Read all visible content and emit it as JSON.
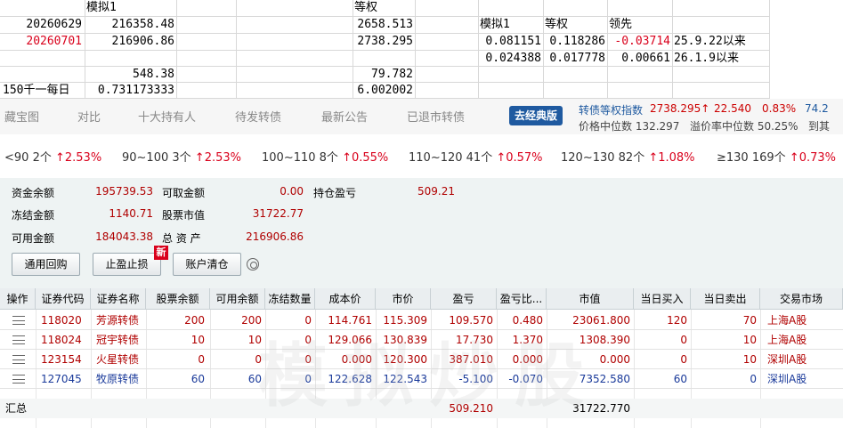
{
  "sheet": {
    "hdr_moni": "模拟1",
    "hdr_dengquan": "等权",
    "r1_date": "20260629",
    "r1_val": "216358.48",
    "r1_idx": "2658.513",
    "r2_date": "20260701",
    "r2_val": "216906.86",
    "r2_idx": "2738.295",
    "sub_hdr_moni": "模拟1",
    "sub_hdr_dengquan": "等权",
    "sub_hdr_lingxian": "领先",
    "s1_moni": "0.081151",
    "s1_dq": "0.118286",
    "s1_lead": "-0.03714",
    "s1_since": "25.9.22以来",
    "s2_moni": "0.024388",
    "s2_dq": "0.017778",
    "s2_lead": "0.00661",
    "s2_since": "26.1.9以来",
    "r4_val": "548.38",
    "r4_idx": "79.782",
    "r5_label": "150千一每日",
    "r5_val": "0.731173333",
    "r5_idx": "6.002002"
  },
  "tabs": {
    "items": [
      "藏宝图",
      "对比",
      "十大持有人",
      "待发转债",
      "最新公告",
      "已退市转债"
    ],
    "classic": "去经典版",
    "index_label": "转债等权指数",
    "index_value": "2738.295↑",
    "index_change": "22.540",
    "index_pct": "0.83%",
    "index_extra": "74.2",
    "median_price": "价格中位数 132.297",
    "premium_median": "溢价率中位数 50.25%",
    "due_label": "到其"
  },
  "buckets": [
    {
      "label": "<90 2个",
      "pct": "↑2.53%"
    },
    {
      "label": "90~100 3个",
      "pct": "↑2.53%"
    },
    {
      "label": "100~110 8个",
      "pct": "↑0.55%"
    },
    {
      "label": "110~120 41个",
      "pct": "↑0.57%"
    },
    {
      "label": "120~130 82个",
      "pct": "↑1.08%"
    },
    {
      "label": "≥130 169个",
      "pct": "↑0.73%"
    }
  ],
  "account": {
    "fund_balance_label": "资金余额",
    "fund_balance": "195739.53",
    "withdrawable_label": "可取金额",
    "withdrawable": "0.00",
    "position_pnl_label": "持仓盈亏",
    "position_pnl": "509.21",
    "frozen_label": "冻结金额",
    "frozen": "1140.71",
    "stock_value_label": "股票市值",
    "stock_value": "31722.77",
    "available_label": "可用金额",
    "available": "184043.38",
    "total_assets_label": "总 资 产",
    "total_assets": "216906.86",
    "btn_repo": "通用回购",
    "btn_stop": "止盈止损",
    "btn_clear": "账户清仓",
    "new_badge": "新"
  },
  "table": {
    "headers": [
      "操作",
      "证券代码",
      "证券名称",
      "股票余额",
      "可用余额",
      "冻结数量",
      "成本价",
      "市价",
      "盈亏",
      "盈亏比...",
      "市值",
      "当日买入",
      "当日卖出",
      "交易市场"
    ],
    "rows": [
      {
        "code": "118020",
        "name": "芳源转债",
        "bal": "200",
        "avail": "200",
        "frozen": "0",
        "cost": "114.761",
        "price": "115.309",
        "pnl": "109.570",
        "ratio": "0.480",
        "mv": "23061.800",
        "buy": "120",
        "sell": "70",
        "market": "上海A股",
        "color": "#b00000"
      },
      {
        "code": "118024",
        "name": "冠宇转债",
        "bal": "10",
        "avail": "10",
        "frozen": "0",
        "cost": "129.066",
        "price": "130.839",
        "pnl": "17.730",
        "ratio": "1.370",
        "mv": "1308.390",
        "buy": "0",
        "sell": "10",
        "market": "上海A股",
        "color": "#b00000"
      },
      {
        "code": "123154",
        "name": "火星转债",
        "bal": "0",
        "avail": "0",
        "frozen": "0",
        "cost": "0.000",
        "price": "120.300",
        "pnl": "387.010",
        "ratio": "0.000",
        "mv": "0.000",
        "buy": "0",
        "sell": "10",
        "market": "深圳A股",
        "color": "#b00000"
      },
      {
        "code": "127045",
        "name": "牧原转债",
        "bal": "60",
        "avail": "60",
        "frozen": "0",
        "cost": "122.628",
        "price": "122.543",
        "pnl": "-5.100",
        "ratio": "-0.070",
        "mv": "7352.580",
        "buy": "60",
        "sell": "0",
        "market": "深圳A股",
        "color": "#1a3a9a"
      }
    ],
    "total_label": "汇总",
    "total_pnl": "509.210",
    "total_mv": "31722.770",
    "watermark": "模拟炒股"
  }
}
